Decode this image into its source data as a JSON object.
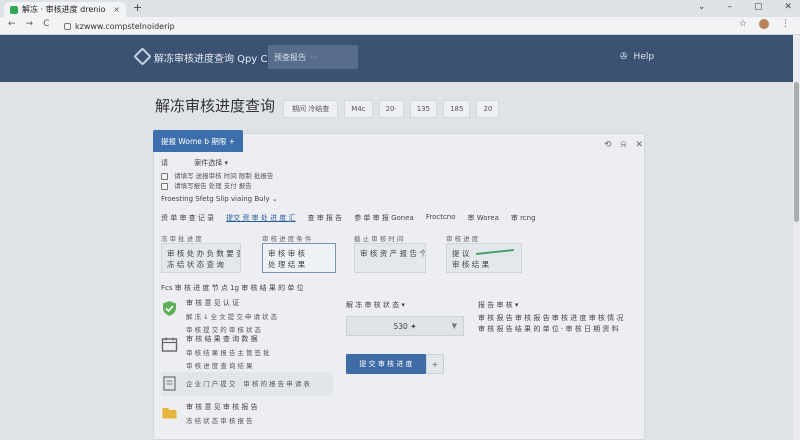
{
  "browser": {
    "tab_title": "解冻 · 审核进度 drenio",
    "tab_close": "×",
    "new_tab": "+",
    "url": "kzwww.compstelnoiderip",
    "nav_back": "←",
    "nav_forward": "→",
    "nav_reload": "C"
  },
  "header": {
    "app_title": "解冻审核进度查询 Qpy Ce",
    "search_label": "预查报告",
    "search_suffix": "···",
    "help_label": "Help"
  },
  "page": {
    "title": "解冻审核进度查询",
    "filters": [
      "期间 冷结查",
      "M4c",
      "20·",
      "135",
      "185",
      "20"
    ]
  },
  "panel": {
    "tab_label": "提报 Wome b 期限 +",
    "request_label": "请",
    "request_type": "案件选择",
    "request_line1": "请填写 送报审核 时间 限制 批报告",
    "request_line2": "请填写报告 处理 支付 报告",
    "policy_line": "Froesting Sfetg Slip viaing Buly",
    "tabs": [
      "资 单 审 查 记 录",
      "提交 资 审 处 进 度 汇",
      "查 审 报 告",
      "参 单 审 报 Gonea",
      "Froctcno",
      "审 Worea",
      "审 rcng"
    ],
    "cards": [
      {
        "label": "冻 审 批 进 度",
        "line1": "审 核 处 办 负 数 要 查",
        "line2": "冻 结 状 态 查 询"
      },
      {
        "label": "审 核 进 度 条 件",
        "line1": "审 核 审 核",
        "line2": "处 理 结 果"
      },
      {
        "label": "截 止 审 核 时 间",
        "line1": "",
        "line2": "审 核 资 产 报 告 个"
      },
      {
        "label": "审 核 进 度",
        "line1": "提 议",
        "line2": "审 核 结 果"
      }
    ],
    "steps_title": "Fcs 审 核 进 度 节 点 1g 审 核 结 果 的 单 位",
    "steps": [
      {
        "title": "审 核 意 见 认 证",
        "line1": "解 冻 ↓ 全 文 提 交 申 请 状 态",
        "line2": "审 核 提 交 的 审 核 状 态"
      },
      {
        "title": "审 核 结 果 查 询 数 据",
        "line1": "审 核 结 果 报 告 主 管 签 批",
        "line2": "审 核 进 度 查 询 结 果"
      },
      {
        "title": "",
        "line1": "企 业 门 户 提 交",
        "line2": "审 核 的 报 告 申 请 表"
      },
      {
        "title": "审 核 意 见 审 核 报 告",
        "line1": "冻 结 状 态 审 核 报 告",
        "line2": ""
      }
    ],
    "amount_label": "解 冻 审 核 状 态",
    "amount_value": "530 ✦",
    "notes_label": "报 告 审 核",
    "notes_line1": "审 核 报 告 审 核 报 告 审 核 进 度 审 核 情 况",
    "notes_line2": "审 核 报 告 结 果 的 单 位 · 审 核 日 期 资 料",
    "submit_label": "提 交 审 核 进 度",
    "submit_plus": "+"
  },
  "colors": {
    "header_bg": "#3c5272",
    "accent": "#3e6fad",
    "success": "#46a36a"
  }
}
